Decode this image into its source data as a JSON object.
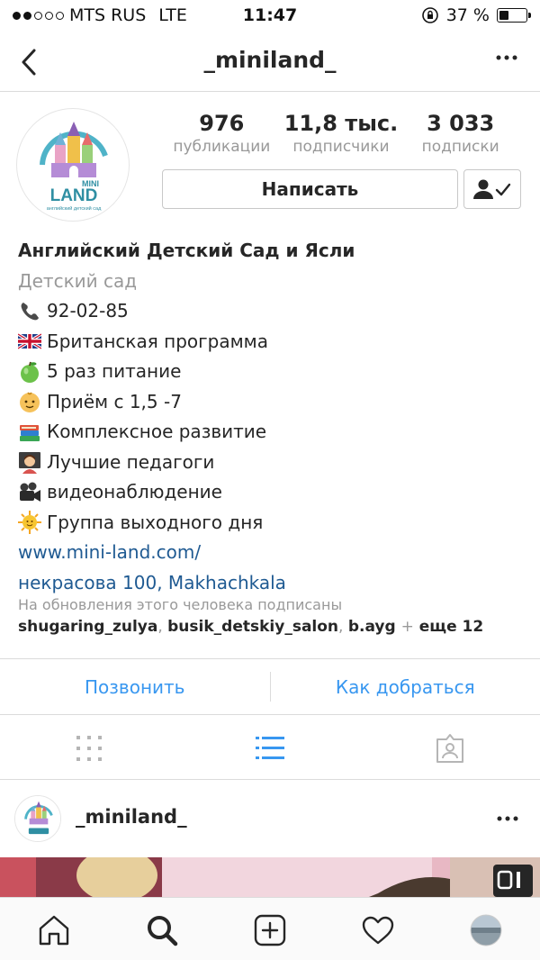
{
  "status": {
    "carrier": "MTS RUS",
    "network": "LTE",
    "time": "11:47",
    "battery": "37 %",
    "battery_level": 0.37
  },
  "nav": {
    "username": "_miniland_"
  },
  "profile": {
    "avatar_lines": [
      "MINI",
      "LAND",
      "английский детский сад"
    ],
    "posts": {
      "value": "976",
      "label": "публикации"
    },
    "followers": {
      "value": "11,8 тыс.",
      "label": "подписчики"
    },
    "following": {
      "value": "3 033",
      "label": "подписки"
    },
    "message_button": "Написать"
  },
  "bio": {
    "name": "Английский Детский Сад и Ясли",
    "category": "Детский сад",
    "lines": [
      {
        "emoji": "phone-icon",
        "text": "92-02-85"
      },
      {
        "emoji": "uk-flag-icon",
        "text": "Британская программа"
      },
      {
        "emoji": "green-apple-icon",
        "text": "5 раз питание"
      },
      {
        "emoji": "baby-icon",
        "text": "Приём с 1,5 -7"
      },
      {
        "emoji": "books-icon",
        "text": "Комплексное развитие"
      },
      {
        "emoji": "teacher-icon",
        "text": "Лучшие педагоги"
      },
      {
        "emoji": "video-camera-icon",
        "text": "видеонаблюдение"
      },
      {
        "emoji": "sun-icon",
        "text": "Группа выходного дня"
      }
    ],
    "website": "www.mini-land.com/",
    "address": "некрасова 100, Makhachkala"
  },
  "followed_by": {
    "label": "На обновления этого человека подписаны",
    "user1": "shugaring_zulya",
    "user2": "busik_detskiy_salon",
    "user3": "b.ayg",
    "plus": "+",
    "more": "еще 12"
  },
  "actions": {
    "call": "Позвонить",
    "directions": "Как добраться"
  },
  "post": {
    "username": "_miniland_"
  },
  "colors": {
    "link": "#3897f0",
    "bio_link": "#1f5a92",
    "muted": "#999999",
    "divider": "#dbdbdb"
  }
}
